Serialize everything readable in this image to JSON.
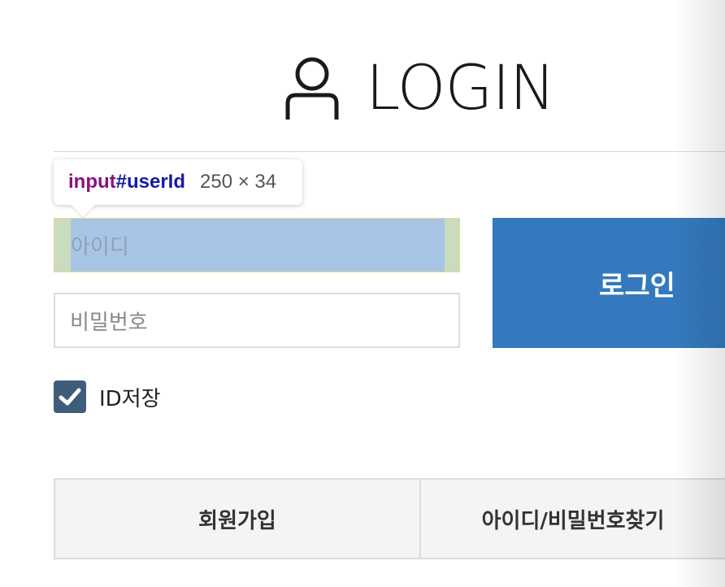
{
  "header": {
    "title": "LOGIN",
    "icon": "user-icon"
  },
  "tooltip": {
    "tag": "input",
    "id": "#userId",
    "size": "250 × 34"
  },
  "form": {
    "id_placeholder": "아이디",
    "password_placeholder": "비밀번호",
    "login_button": "로그인",
    "save_id_label": "ID저장",
    "save_id_checked": true
  },
  "links": {
    "join": "회원가입",
    "find": "아이디/비밀번호찾기"
  },
  "colors": {
    "primary": "#3479bd",
    "checkbox": "#3f5d7a",
    "tooltip_tag": "#881280",
    "tooltip_id": "#1a1aa6"
  }
}
